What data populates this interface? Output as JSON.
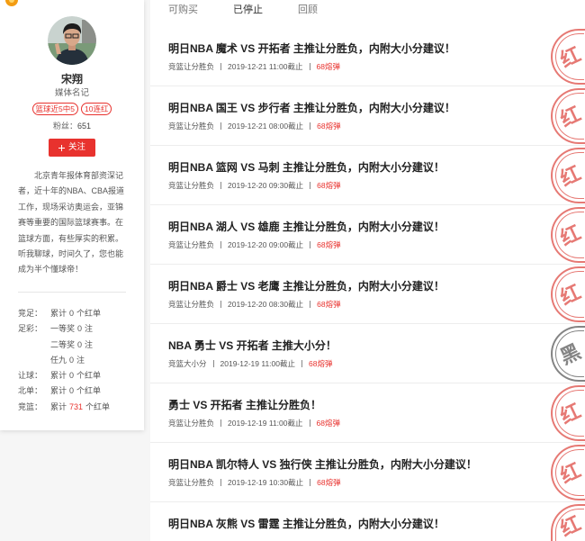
{
  "tabs": [
    {
      "label": "可购买",
      "active": false
    },
    {
      "label": "已停止",
      "active": true
    },
    {
      "label": "回顾",
      "active": false
    }
  ],
  "profile": {
    "name": "宋翔",
    "role": "媒体名记",
    "badges": [
      "篮球近5中5",
      "10连红"
    ],
    "fans_label": "粉丝：",
    "fans_count": "651",
    "follow_label": "关注",
    "bio": "北京青年报体育部资深记者，近十年的NBA、CBA报道工作，现场采访奥运会，亚锦赛等重要的国际篮球赛事。在篮球方面，有些厚实的积累。听我聊球，时间久了，您也能成为半个懂球帝！"
  },
  "stats": [
    {
      "label": "竞足：",
      "prefix": "累计",
      "count": "0",
      "suffix": "个红单"
    },
    {
      "label": "足彩：",
      "prefix": "一等奖",
      "count": "0",
      "suffix": "注"
    },
    {
      "label": "",
      "prefix": "二等奖",
      "count": "0",
      "suffix": "注"
    },
    {
      "label": "",
      "prefix": "任九",
      "count": "0",
      "suffix": "注"
    },
    {
      "label": "让球：",
      "prefix": "累计",
      "count": "0",
      "suffix": "个红单"
    },
    {
      "label": "北单：",
      "prefix": "累计",
      "count": "0",
      "suffix": "个红单"
    },
    {
      "label": "竞篮：",
      "prefix": "累计",
      "count": "731",
      "suffix": "个红单"
    }
  ],
  "articles": [
    {
      "title": "明日NBA 魔术 VS 开拓者 主推让分胜负，内附大小分建议！",
      "type": "竞篮让分胜负",
      "deadline": "2019-12-21 11:00截止",
      "price": "68熔弹",
      "result": "红"
    },
    {
      "title": "明日NBA 国王 VS 步行者 主推让分胜负，内附大小分建议！",
      "type": "竞篮让分胜负",
      "deadline": "2019-12-21 08:00截止",
      "price": "68熔弹",
      "result": "红"
    },
    {
      "title": "明日NBA 篮网 VS 马刺 主推让分胜负，内附大小分建议！",
      "type": "竞篮让分胜负",
      "deadline": "2019-12-20 09:30截止",
      "price": "68熔弹",
      "result": "红"
    },
    {
      "title": "明日NBA 湖人 VS 雄鹿 主推让分胜负，内附大小分建议！",
      "type": "竞篮让分胜负",
      "deadline": "2019-12-20 09:00截止",
      "price": "68熔弹",
      "result": "红"
    },
    {
      "title": "明日NBA 爵士 VS 老鹰 主推让分胜负，内附大小分建议！",
      "type": "竞篮让分胜负",
      "deadline": "2019-12-20 08:30截止",
      "price": "68熔弹",
      "result": "红"
    },
    {
      "title": "NBA 勇士 VS 开拓者 主推大小分！",
      "type": "竞篮大小分",
      "deadline": "2019-12-19 11:00截止",
      "price": "68熔弹",
      "result": "黑"
    },
    {
      "title": "勇士 VS 开拓者 主推让分胜负！",
      "type": "竞篮让分胜负",
      "deadline": "2019-12-19 11:00截止",
      "price": "68熔弹",
      "result": "红"
    },
    {
      "title": "明日NBA 凯尔特人 VS 独行侠 主推让分胜负，内附大小分建议！",
      "type": "竞篮让分胜负",
      "deadline": "2019-12-19 10:30截止",
      "price": "68熔弹",
      "result": "红"
    },
    {
      "title": "明日NBA 灰熊 VS 雷霆 主推让分胜负，内附大小分建议！",
      "result": "红"
    }
  ],
  "icons": {
    "corner_badge": "medal-icon",
    "follow": "plus-icon"
  },
  "colors": {
    "accent": "#e8322e",
    "stamp_red": "#e46b65",
    "stamp_black": "#777777"
  }
}
